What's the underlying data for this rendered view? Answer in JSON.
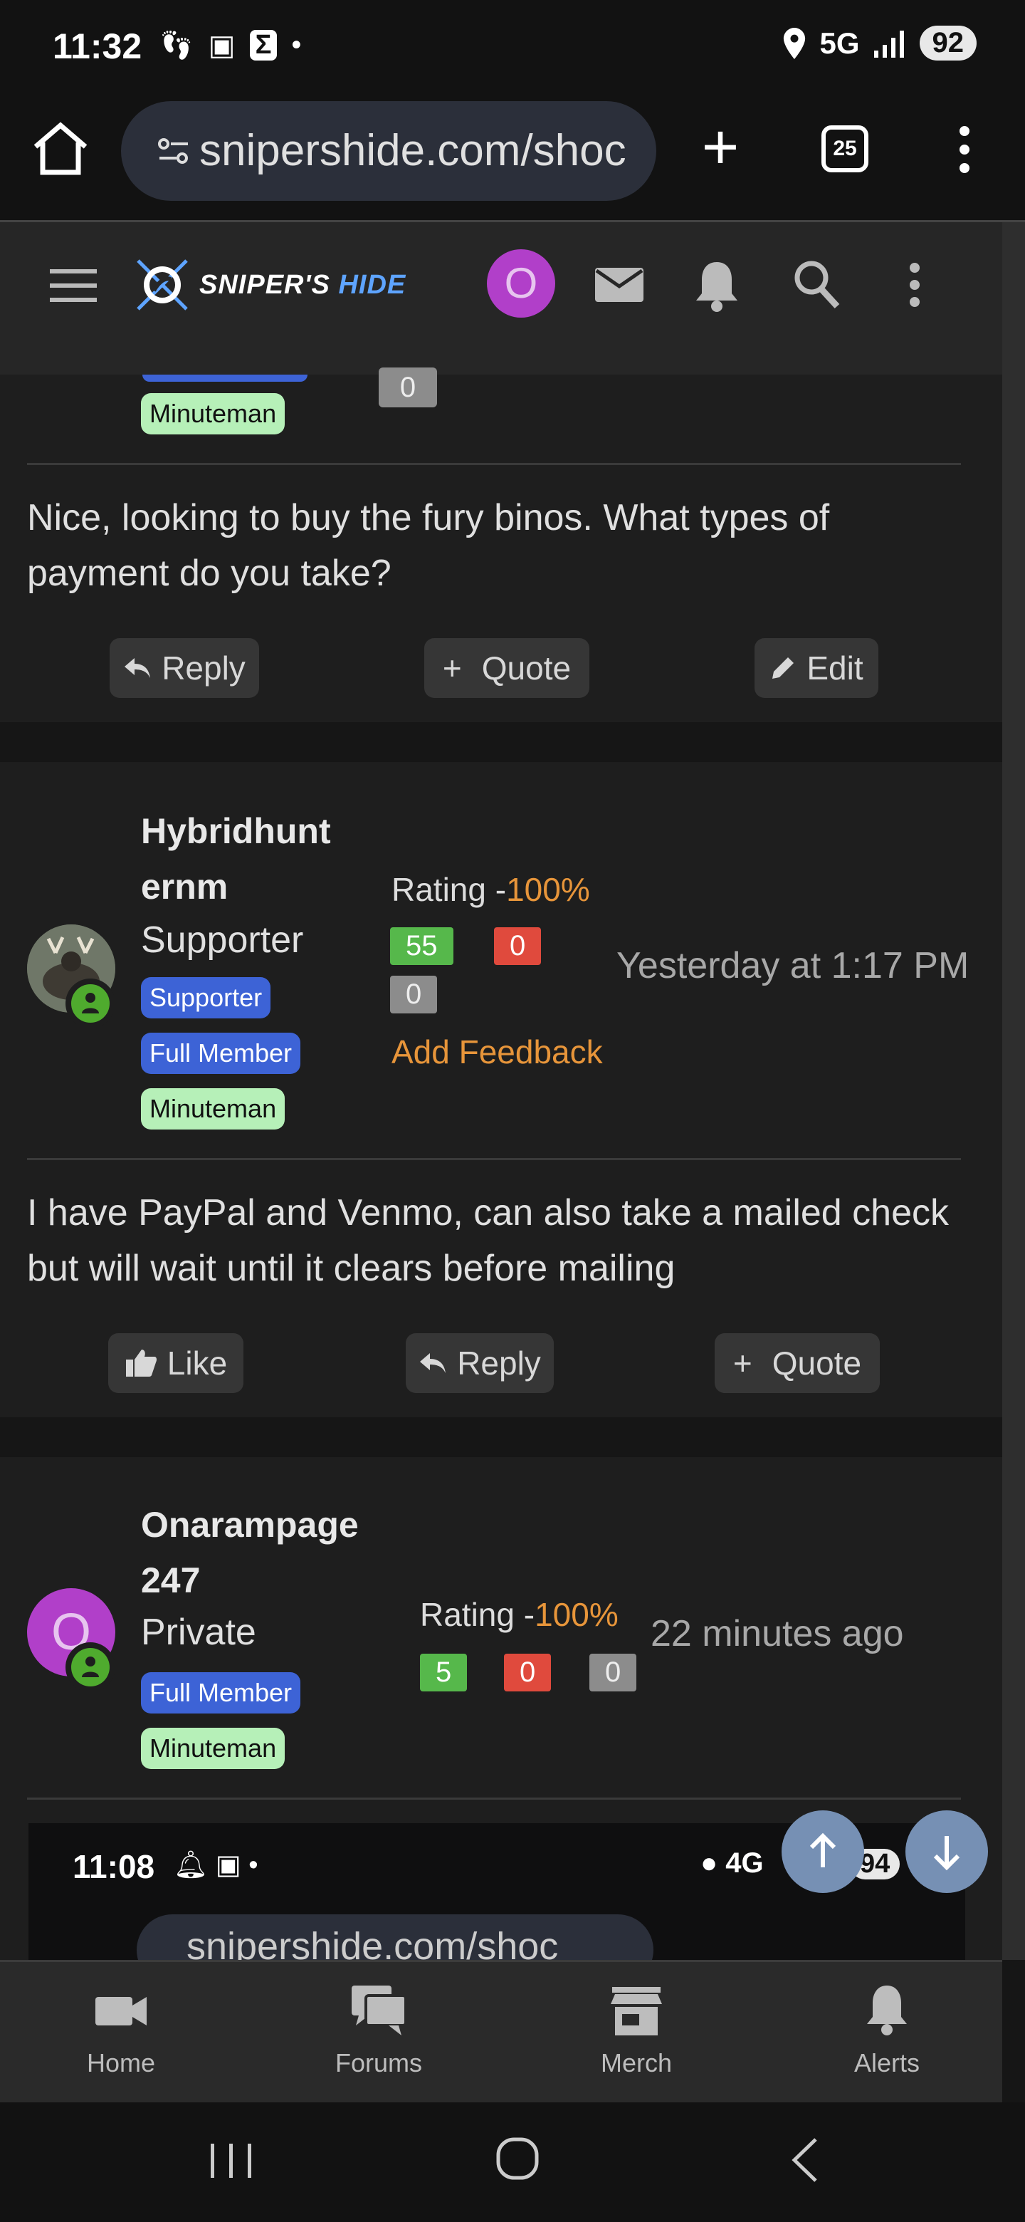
{
  "status": {
    "time": "11:32",
    "network": "5G",
    "battery": "92"
  },
  "browser": {
    "url": "snipershide.com/shoc",
    "tab_count": "25"
  },
  "header": {
    "logo_text_a": "SNIPER'S",
    "logo_text_b": "HIDE",
    "avatar_letter": "O"
  },
  "post1": {
    "badge": "Minuteman",
    "chip": "0",
    "body": "Nice, looking to buy the fury binos. What types of payment do you take?",
    "actions": {
      "reply": "Reply",
      "quote": "Quote",
      "edit": "Edit"
    }
  },
  "post2": {
    "username_line1": "Hybridhunt",
    "username_line2": "ernm",
    "title": "Supporter",
    "badges": [
      "Supporter",
      "Full Member",
      "Minuteman"
    ],
    "rating_label": "Rating -",
    "rating_value": "100%",
    "positive": "55",
    "negative": "0",
    "neutral": "0",
    "add_feedback": "Add Feedback",
    "time": "Yesterday at 1:17 PM",
    "body": "I have PayPal and Venmo, can also take a mailed check but will wait until it clears before mailing",
    "actions": {
      "like": "Like",
      "reply": "Reply",
      "quote": "Quote"
    }
  },
  "post3": {
    "username_line1": "Onarampage",
    "username_line2": "247",
    "avatar_letter": "O",
    "title": "Private",
    "badges": [
      "Full Member",
      "Minuteman"
    ],
    "rating_label": "Rating -",
    "rating_value": "100%",
    "positive": "5",
    "negative": "0",
    "neutral": "0",
    "time": "22 minutes ago"
  },
  "embedded": {
    "time": "11:08",
    "network": "4G",
    "battery": "94",
    "url": "snipershide.com/shoc"
  },
  "bottom_nav": {
    "items": [
      "Home",
      "Forums",
      "Merch",
      "Alerts"
    ]
  },
  "colors": {
    "accent_orange": "#e7953a",
    "badge_blue": "#3d63d6",
    "badge_green": "#b6f0b8",
    "avatar_purple": "#b13fc9"
  }
}
